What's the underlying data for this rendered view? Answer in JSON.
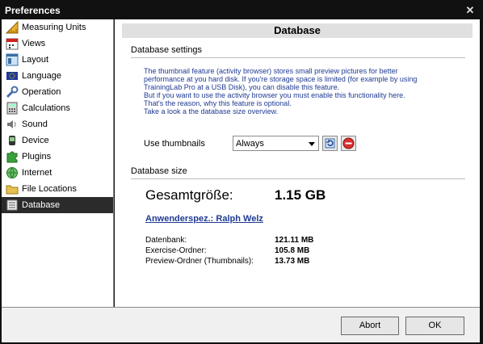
{
  "window": {
    "title": "Preferences"
  },
  "sidebar": {
    "items": [
      {
        "label": "Measuring Units",
        "icon": "ruler-icon",
        "active": false
      },
      {
        "label": "Views",
        "icon": "calendar-icon",
        "active": false
      },
      {
        "label": "Layout",
        "icon": "layout-icon",
        "active": false
      },
      {
        "label": "Language",
        "icon": "flag-icon",
        "active": false
      },
      {
        "label": "Operation",
        "icon": "wrench-icon",
        "active": false
      },
      {
        "label": "Calculations",
        "icon": "calculator-icon",
        "active": false
      },
      {
        "label": "Sound",
        "icon": "speaker-icon",
        "active": false
      },
      {
        "label": "Device",
        "icon": "device-icon",
        "active": false
      },
      {
        "label": "Plugins",
        "icon": "puzzle-icon",
        "active": false
      },
      {
        "label": "Internet",
        "icon": "globe-icon",
        "active": false
      },
      {
        "label": "File Locations",
        "icon": "folder-icon",
        "active": false
      },
      {
        "label": "Database",
        "icon": "database-icon",
        "active": true
      }
    ]
  },
  "main": {
    "header": "Database",
    "settings_title": "Database settings",
    "description": [
      "The thumbnail feature (activity browser) stores small preview pictures for better",
      "performance at you hard disk. If you're storage space is limited (for example by using",
      "TrainingLab Pro at a USB Disk), you can disable this feature.",
      "But if you want to use the activity browser you must enable this functionality here.",
      "That's the reason, why this feature is optional.",
      "Take a look a the database size overview."
    ],
    "thumbnails_label": "Use thumbnails",
    "thumbnails_value": "Always",
    "size_title": "Database size",
    "total_label": "Gesamtgröße:",
    "total_value": "1.15 GB",
    "user_link": "Anwenderspez.: Ralph Welz",
    "sizes": [
      {
        "label": "Datenbank:",
        "value": "121.11 MB"
      },
      {
        "label": "Exercise-Ordner:",
        "value": "105.8 MB"
      },
      {
        "label": "Preview-Ordner (Thumbnails):",
        "value": "13.73 MB"
      }
    ]
  },
  "buttons": {
    "abort": "Abort",
    "ok": "OK"
  },
  "colors": {
    "description_text": "#1f3a93",
    "active_item_bg": "#2b2b2b",
    "titlebar_bg": "#111111"
  }
}
